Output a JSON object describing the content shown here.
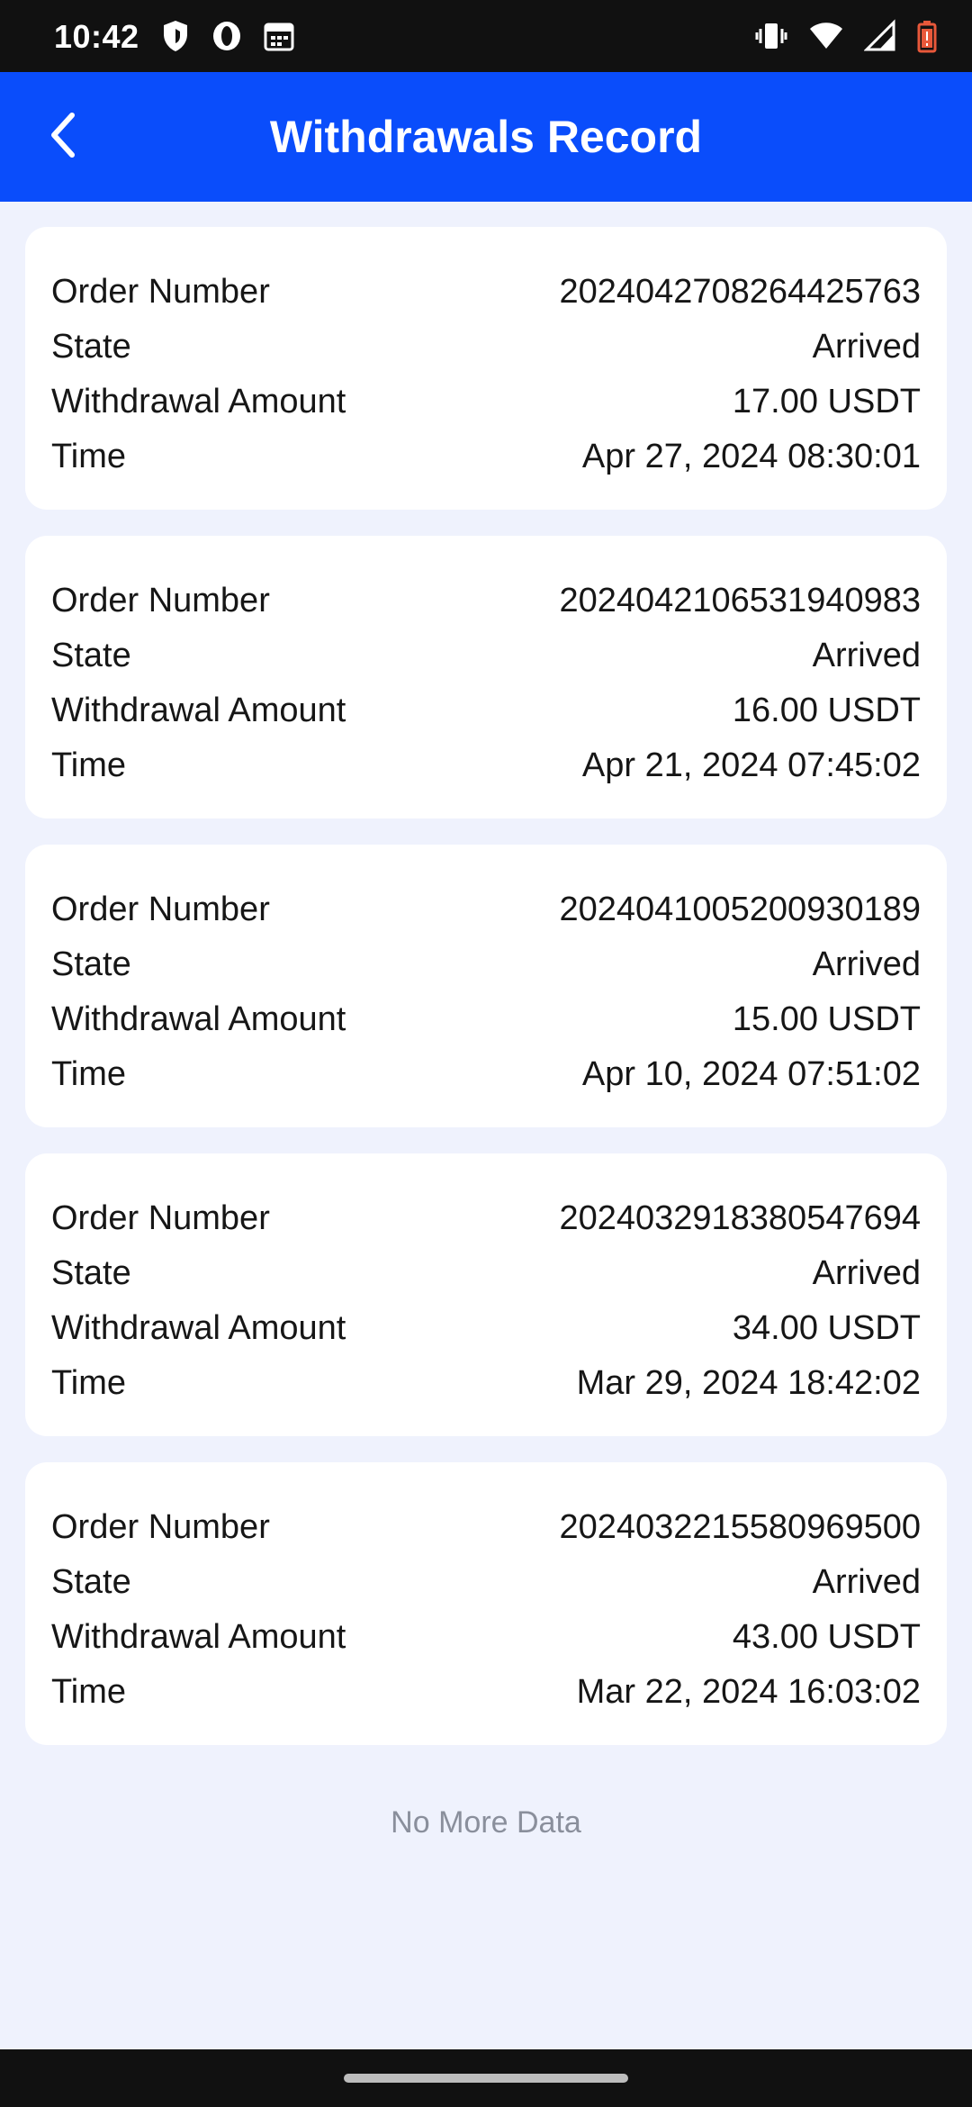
{
  "status_bar": {
    "time": "10:42",
    "left_icons": [
      "shield-icon",
      "opera-icon",
      "calendar-icon"
    ],
    "right_icons": [
      "vibrate-icon",
      "wifi-icon",
      "signal-icon",
      "battery-low-icon"
    ],
    "battery_color": "#e8583a"
  },
  "header": {
    "title": "Withdrawals Record",
    "back_icon": "chevron-left-icon",
    "background": "#0a4dfb"
  },
  "labels": {
    "order_number": "Order Number",
    "state": "State",
    "amount": "Withdrawal Amount",
    "time": "Time"
  },
  "records": [
    {
      "order_number": "2024042708264425763",
      "state": "Arrived",
      "amount": "17.00 USDT",
      "time": "Apr 27, 2024 08:30:01"
    },
    {
      "order_number": "2024042106531940983",
      "state": "Arrived",
      "amount": "16.00 USDT",
      "time": "Apr 21, 2024 07:45:02"
    },
    {
      "order_number": "2024041005200930189",
      "state": "Arrived",
      "amount": "15.00 USDT",
      "time": "Apr 10, 2024 07:51:02"
    },
    {
      "order_number": "2024032918380547694",
      "state": "Arrived",
      "amount": "34.00 USDT",
      "time": "Mar 29, 2024 18:42:02"
    },
    {
      "order_number": "2024032215580969500",
      "state": "Arrived",
      "amount": "43.00 USDT",
      "time": "Mar 22, 2024 16:03:02"
    }
  ],
  "footer": {
    "no_more": "No More Data"
  }
}
